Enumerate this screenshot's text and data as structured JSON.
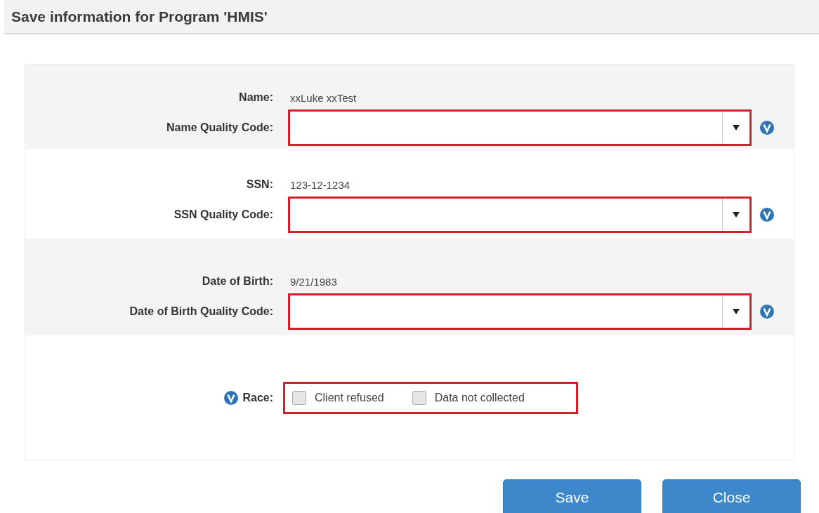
{
  "title": "Save information for Program 'HMIS'",
  "sections": [
    {
      "kind": "select",
      "label": "Name:",
      "value": "xxLuke xxTest",
      "quality_label": "Name Quality Code:",
      "highlighted": true
    },
    {
      "kind": "select",
      "label": "SSN:",
      "value": "123-12-1234",
      "quality_label": "SSN Quality Code:",
      "highlighted": true
    },
    {
      "kind": "select",
      "label": "Date of Birth:",
      "value": "9/21/1983",
      "quality_label": "Date of Birth Quality Code:",
      "highlighted": true
    },
    {
      "kind": "checkboxes",
      "label": "Race:",
      "highlighted": true,
      "options": [
        {
          "label": "Client refused",
          "checked": false
        },
        {
          "label": "Data not collected",
          "checked": false
        }
      ]
    }
  ],
  "buttons": [
    "Save",
    "Close"
  ]
}
